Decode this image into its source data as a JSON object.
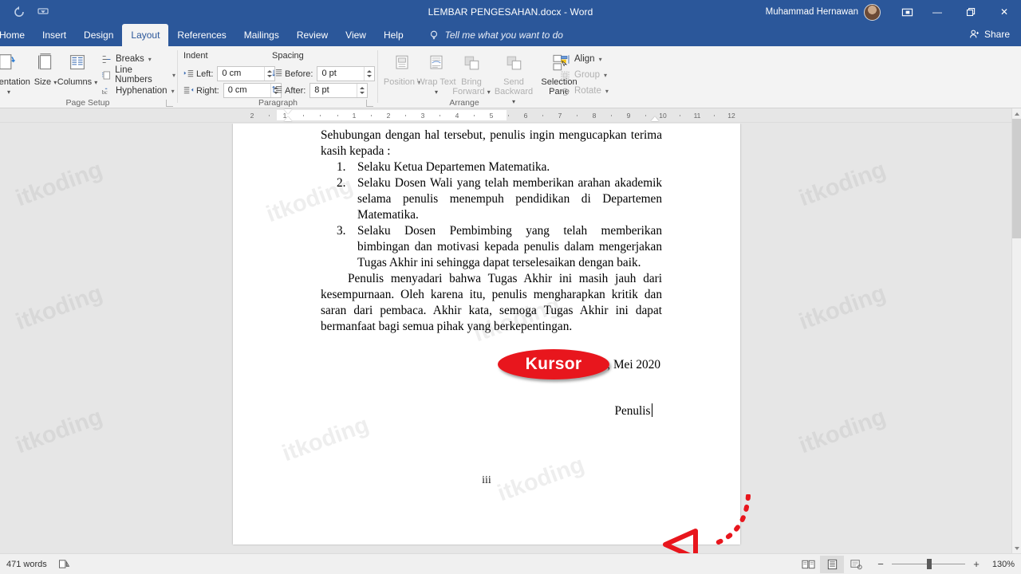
{
  "titlebar": {
    "document_title": "LEMBAR PENGESAHAN.docx  -  Word",
    "user_name": "Muhammad Hernawan",
    "qat": [
      {
        "name": "undo-icon",
        "label": "Undo"
      },
      {
        "name": "customize-qat-icon",
        "label": "Customize Quick Access Toolbar"
      }
    ],
    "window_controls": {
      "ribbon_display_options": "Ribbon Display Options",
      "minimize": "—",
      "restore": "❐",
      "close": "✕"
    }
  },
  "tabs": [
    {
      "label": "Home",
      "active": false
    },
    {
      "label": "Insert",
      "active": false
    },
    {
      "label": "Design",
      "active": false
    },
    {
      "label": "Layout",
      "active": true
    },
    {
      "label": "References",
      "active": false
    },
    {
      "label": "Mailings",
      "active": false
    },
    {
      "label": "Review",
      "active": false
    },
    {
      "label": "View",
      "active": false
    },
    {
      "label": "Help",
      "active": false
    }
  ],
  "tellme": {
    "placeholder": "Tell me what you want to do",
    "icon": "lightbulb-icon"
  },
  "share": {
    "label": "Share",
    "icon": "share-person-icon"
  },
  "ribbon": {
    "page_setup": {
      "group_label": "Page Setup",
      "buttons": [
        {
          "label": "Orientation",
          "caret": "▾"
        },
        {
          "label": "Size",
          "caret": "▾"
        },
        {
          "label": "Columns",
          "caret": "▾"
        }
      ],
      "menu_items": [
        {
          "label": "Breaks",
          "caret": "▾",
          "icon": "breaks-icon"
        },
        {
          "label": "Line Numbers",
          "caret": "▾",
          "icon": "line-numbers-icon"
        },
        {
          "label": "Hyphenation",
          "caret": "▾",
          "icon": "hyphenation-icon"
        }
      ]
    },
    "paragraph": {
      "group_label": "Paragraph",
      "indent_header": "Indent",
      "spacing_header": "Spacing",
      "fields": [
        {
          "label": "Left:",
          "value": "0 cm",
          "icon": "indent-left-icon"
        },
        {
          "label": "Right:",
          "value": "0 cm",
          "icon": "indent-right-icon"
        },
        {
          "label": "Before:",
          "value": "0 pt",
          "icon": "spacing-before-icon"
        },
        {
          "label": "After:",
          "value": "8 pt",
          "icon": "spacing-after-icon"
        }
      ]
    },
    "arrange": {
      "group_label": "Arrange",
      "buttons": [
        {
          "label": "Position",
          "caret": "▾",
          "disabled": false
        },
        {
          "label": "Wrap Text",
          "caret": "▾",
          "disabled": false
        },
        {
          "label": "Bring Forward",
          "caret": "▾",
          "disabled": true
        },
        {
          "label": "Send Backward",
          "caret": "▾",
          "disabled": true
        },
        {
          "label": "Selection Pane",
          "caret": "",
          "disabled": false
        }
      ],
      "menu_items": [
        {
          "label": "Align",
          "caret": "▾",
          "disabled": false,
          "icon": "align-icon"
        },
        {
          "label": "Group",
          "caret": "▾",
          "disabled": true,
          "icon": "group-icon"
        },
        {
          "label": "Rotate",
          "caret": "▾",
          "disabled": true,
          "icon": "rotate-icon"
        }
      ]
    }
  },
  "ruler": {
    "left_margin_ticks": [
      "2",
      "1"
    ],
    "body_ticks": [
      "1",
      "2",
      "3",
      "4",
      "5",
      "6",
      "7",
      "8",
      "9"
    ],
    "right_margin_ticks": [
      "10",
      "11",
      "12"
    ]
  },
  "document": {
    "intro": "Sehubungan dengan hal tersebut, penulis ingin mengucapkan terima kasih kepada :",
    "list": [
      {
        "num": "1.",
        "text": "Selaku Ketua Departemen Matematika."
      },
      {
        "num": "2.",
        "text": "Selaku Dosen Wali yang telah memberikan arahan akademik selama penulis menempuh pendidikan di Departemen Matematika."
      },
      {
        "num": "3.",
        "text": "Selaku Dosen Pembimbing yang telah memberikan bimbingan dan motivasi kepada penulis dalam mengerjakan Tugas Akhir ini sehingga dapat terselesaikan dengan baik."
      }
    ],
    "closing": "Penulis menyadari bahwa Tugas Akhir ini masih jauh dari kesempurnaan. Oleh karena itu, penulis mengharapkan kritik dan saran dari pembaca. Akhir kata, semoga Tugas Akhir ini dapat bermanfaat bagi semua pihak yang berkepentingan.",
    "signature_date": "Surabaya, Mei 2020",
    "signature_name": "Penulis",
    "page_number": "iii",
    "watermark_text": "itkoding"
  },
  "annotation": {
    "label": "Kursor",
    "color": "#e8161d"
  },
  "statusbar": {
    "word_count": "471 words",
    "proofing_icon": "proofing-errors-icon",
    "views": [
      {
        "name": "read-mode",
        "active": false
      },
      {
        "name": "print-layout",
        "active": true
      },
      {
        "name": "web-layout",
        "active": false
      }
    ],
    "zoom_out": "−",
    "zoom_in": "+",
    "zoom_level": "130%"
  }
}
